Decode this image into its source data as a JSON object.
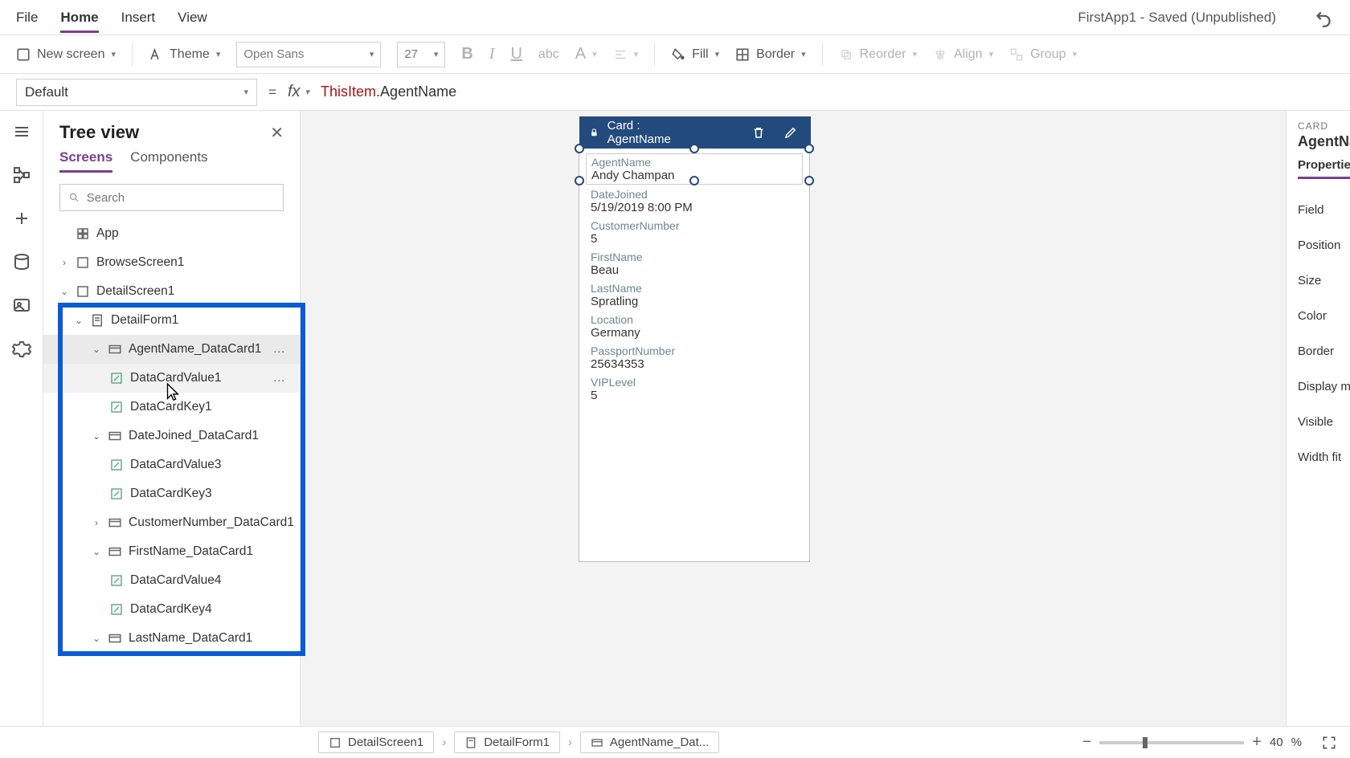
{
  "menubar": {
    "file": "File",
    "home": "Home",
    "insert": "Insert",
    "view": "View",
    "appTitle": "FirstApp1 - Saved (Unpublished)"
  },
  "toolbar": {
    "newScreen": "New screen",
    "theme": "Theme",
    "font": "Open Sans",
    "fontSize": "27",
    "fill": "Fill",
    "border": "Border",
    "reorder": "Reorder",
    "align": "Align",
    "group": "Group"
  },
  "formulaBar": {
    "property": "Default",
    "formula_part1": "ThisItem",
    "formula_part2": ".AgentName"
  },
  "treeView": {
    "title": "Tree view",
    "tabs": {
      "screens": "Screens",
      "components": "Components"
    },
    "searchPlaceholder": "Search",
    "nodes": {
      "app": "App",
      "browseScreen": "BrowseScreen1",
      "detailScreen": "DetailScreen1",
      "detailForm": "DetailForm1",
      "agentNameCard": "AgentName_DataCard1",
      "dataCardValue1": "DataCardValue1",
      "dataCardKey1": "DataCardKey1",
      "dateJoinedCard": "DateJoined_DataCard1",
      "dataCardValue3": "DataCardValue3",
      "dataCardKey3": "DataCardKey3",
      "customerNumberCard": "CustomerNumber_DataCard1",
      "firstNameCard": "FirstName_DataCard1",
      "dataCardValue4": "DataCardValue4",
      "dataCardKey4": "DataCardKey4",
      "lastNameCard": "LastName_DataCard1"
    }
  },
  "canvas": {
    "cardTitle": "Card : AgentName",
    "fields": [
      {
        "label": "AgentName",
        "value": "Andy Champan"
      },
      {
        "label": "DateJoined",
        "value": "5/19/2019 8:00 PM"
      },
      {
        "label": "CustomerNumber",
        "value": "5"
      },
      {
        "label": "FirstName",
        "value": "Beau"
      },
      {
        "label": "LastName",
        "value": "Spratling"
      },
      {
        "label": "Location",
        "value": "Germany"
      },
      {
        "label": "PassportNumber",
        "value": "25634353"
      },
      {
        "label": "VIPLevel",
        "value": "5"
      }
    ]
  },
  "props": {
    "type": "CARD",
    "name": "AgentNam",
    "tab": "Properties",
    "rows": [
      "Field",
      "Position",
      "Size",
      "Color",
      "Border",
      "Display mo",
      "Visible",
      "Width fit"
    ]
  },
  "footer": {
    "crumbs": [
      "DetailScreen1",
      "DetailForm1",
      "AgentName_Dat..."
    ],
    "zoomPct": "40",
    "pct": "%"
  }
}
